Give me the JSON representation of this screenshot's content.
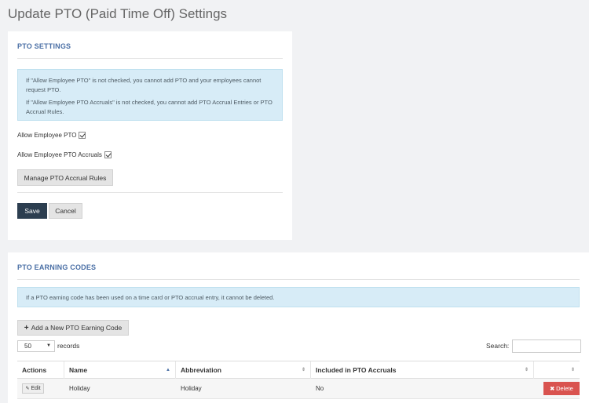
{
  "page": {
    "title": "Update PTO (Paid Time Off) Settings"
  },
  "pto_settings": {
    "header": "PTO SETTINGS",
    "info_line1": "If \"Allow Employee PTO\" is not checked, you cannot add PTO and your employees cannot request PTO.",
    "info_line2": "If \"Allow Employee PTO Accruals\" is not checked, you cannot add PTO Accrual Entries or PTO Accrual Rules.",
    "allow_pto_label": "Allow Employee PTO",
    "allow_pto_checked": true,
    "allow_accruals_label": "Allow Employee PTO Accruals",
    "allow_accruals_checked": true,
    "manage_rules_label": "Manage PTO Accrual Rules",
    "save_label": "Save",
    "cancel_label": "Cancel"
  },
  "earning_codes": {
    "header": "PTO EARNING CODES",
    "info": "If a PTO earning code has been used on a time card or PTO accrual entry, it cannot be deleted.",
    "add_label": "Add a New PTO Earning Code",
    "page_length": "50",
    "records_label": "records",
    "search_label": "Search:",
    "columns": [
      "Actions",
      "Name",
      "Abbreviation",
      "Included in PTO Accruals"
    ],
    "rows": [
      {
        "edit_label": "Edit",
        "name": "Holiday",
        "abbreviation": "Holiday",
        "included": "No",
        "delete_label": "Delete"
      }
    ]
  },
  "colors": {
    "primary": "#2c3e50",
    "header_text": "#4a6fa5",
    "info_bg": "#d7ecf7",
    "danger": "#d9534f"
  }
}
